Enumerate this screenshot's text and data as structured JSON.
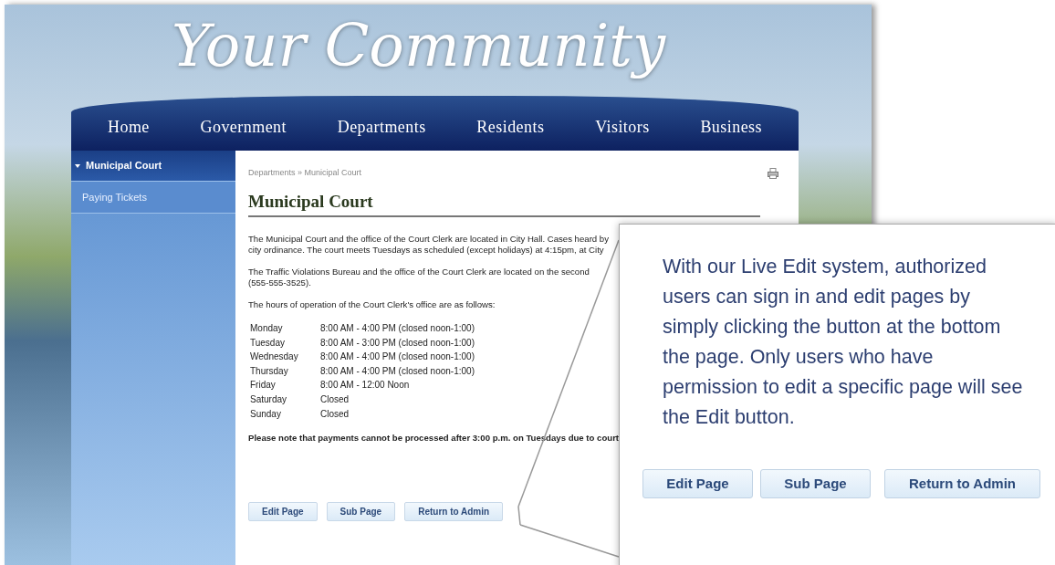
{
  "site": {
    "logo": "Your Community"
  },
  "nav": [
    {
      "label": "Home"
    },
    {
      "label": "Government"
    },
    {
      "label": "Departments"
    },
    {
      "label": "Residents"
    },
    {
      "label": "Visitors"
    },
    {
      "label": "Business"
    }
  ],
  "sidebar": {
    "items": [
      {
        "label": "Municipal Court",
        "expanded": true,
        "selected": true
      },
      {
        "label": "Paying Tickets",
        "expanded": false,
        "selected": false
      }
    ]
  },
  "content": {
    "breadcrumb": [
      "Departments",
      "Municipal Court"
    ],
    "breadcrumb_separator": "»",
    "title": "Municipal Court",
    "paragraphs": [
      [
        "The Municipal Court and the office of the Court Clerk are located in City Hall. Cases heard by",
        "city ordinance. The court meets Tuesdays as scheduled (except holidays) at 4:15pm, at City"
      ],
      [
        "The Traffic Violations Bureau and the office of the Court Clerk are located on the second",
        "(555-555-3525)."
      ],
      [
        "The hours of operation of the Court Clerk's office are as follows:"
      ]
    ],
    "hours": [
      {
        "day": "Monday",
        "hours": "8:00 AM - 4:00 PM (closed noon-1:00)"
      },
      {
        "day": "Tuesday",
        "hours": "8:00 AM - 3:00 PM (closed noon-1:00)"
      },
      {
        "day": "Wednesday",
        "hours": "8:00 AM - 4:00 PM (closed noon-1:00)"
      },
      {
        "day": "Thursday",
        "hours": "8:00 AM - 4:00 PM (closed noon-1:00)"
      },
      {
        "day": "Friday",
        "hours": "8:00 AM - 12:00 Noon"
      },
      {
        "day": "Saturday",
        "hours": "Closed"
      },
      {
        "day": "Sunday",
        "hours": "Closed"
      }
    ],
    "note": "Please note that payments cannot be processed after 3:00 p.m. on Tuesdays due to court",
    "buttons": [
      "Edit Page",
      "Sub Page",
      "Return to Admin"
    ]
  },
  "callout": {
    "text": "With our Live Edit system, authorized users can sign in and edit pages by simply clicking the button at the bottom the page. Only users who have permission to edit a specific page will see the Edit button.",
    "buttons": [
      "Edit Page",
      "Sub Page",
      "Return to Admin"
    ]
  }
}
